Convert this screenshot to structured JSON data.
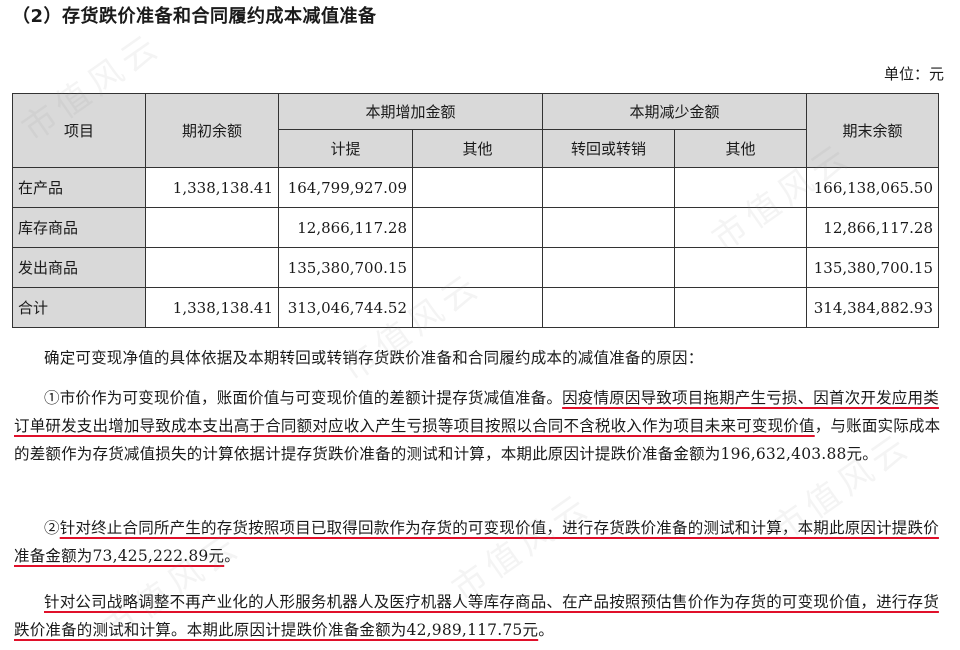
{
  "section": {
    "title": "（2）存货跌价准备和合同履约成本减值准备"
  },
  "unit_label": "单位：元",
  "table": {
    "headers": {
      "item": "项目",
      "opening": "期初余额",
      "increase": "本期增加金额",
      "decrease": "本期减少金额",
      "closing": "期末余额",
      "provision": "计提",
      "other_inc": "其他",
      "reversal": "转回或转销",
      "other_dec": "其他"
    },
    "rows": [
      {
        "item": "在产品",
        "opening": "1,338,138.41",
        "provision": "164,799,927.09",
        "other_inc": "",
        "reversal": "",
        "other_dec": "",
        "closing": "166,138,065.50"
      },
      {
        "item": "库存商品",
        "opening": "",
        "provision": "12,866,117.28",
        "other_inc": "",
        "reversal": "",
        "other_dec": "",
        "closing": "12,866,117.28"
      },
      {
        "item": "发出商品",
        "opening": "",
        "provision": "135,380,700.15",
        "other_inc": "",
        "reversal": "",
        "other_dec": "",
        "closing": "135,380,700.15"
      },
      {
        "item": "合计",
        "opening": "1,338,138.41",
        "provision": "313,046,744.52",
        "other_inc": "",
        "reversal": "",
        "other_dec": "",
        "closing": "314,384,882.93"
      }
    ]
  },
  "paragraphs": {
    "intro": "确定可变现净值的具体依据及本期转回或转销存货跌价准备和合同履约成本的减值准备的原因：",
    "p1_a": "①市价作为可变现价值，账面价值与可变现价值的差额计提存货减值准备。",
    "p1_b": "因疫情原因导致项目拖期产生亏损、因首次开发应用类订单研发支出增加导致成本支出高于合同额对应收入产生亏损等项目按照以合同不含税收入作为项目未来可变现价值",
    "p1_c": "，与账面实际成本的差额作为存货减值损失的计算依据计提存货跌价准备的测试和计算，本期此原因计提跌价准备金额为196,632,403.88元。",
    "p2_a": "②",
    "p2_b": "针对终止合同所产生的存货按照项目已取得回款作为存货的可变现价值，进行存货跌价准备的测试和计算，本期此原因计提跌价准备金额为73,425,222.89元",
    "p2_c": "。",
    "p3_a": "针对公司战略调整不再产业化的人形服务机器人及医疗机器人等库存商品、在产品按照预估售价作为存货的可变现价值，进行存货跌价准备的测试和计算。本期此原因计提跌价准备金额为42,989,117.75元",
    "p3_b": "。"
  },
  "watermark": "市值风云"
}
